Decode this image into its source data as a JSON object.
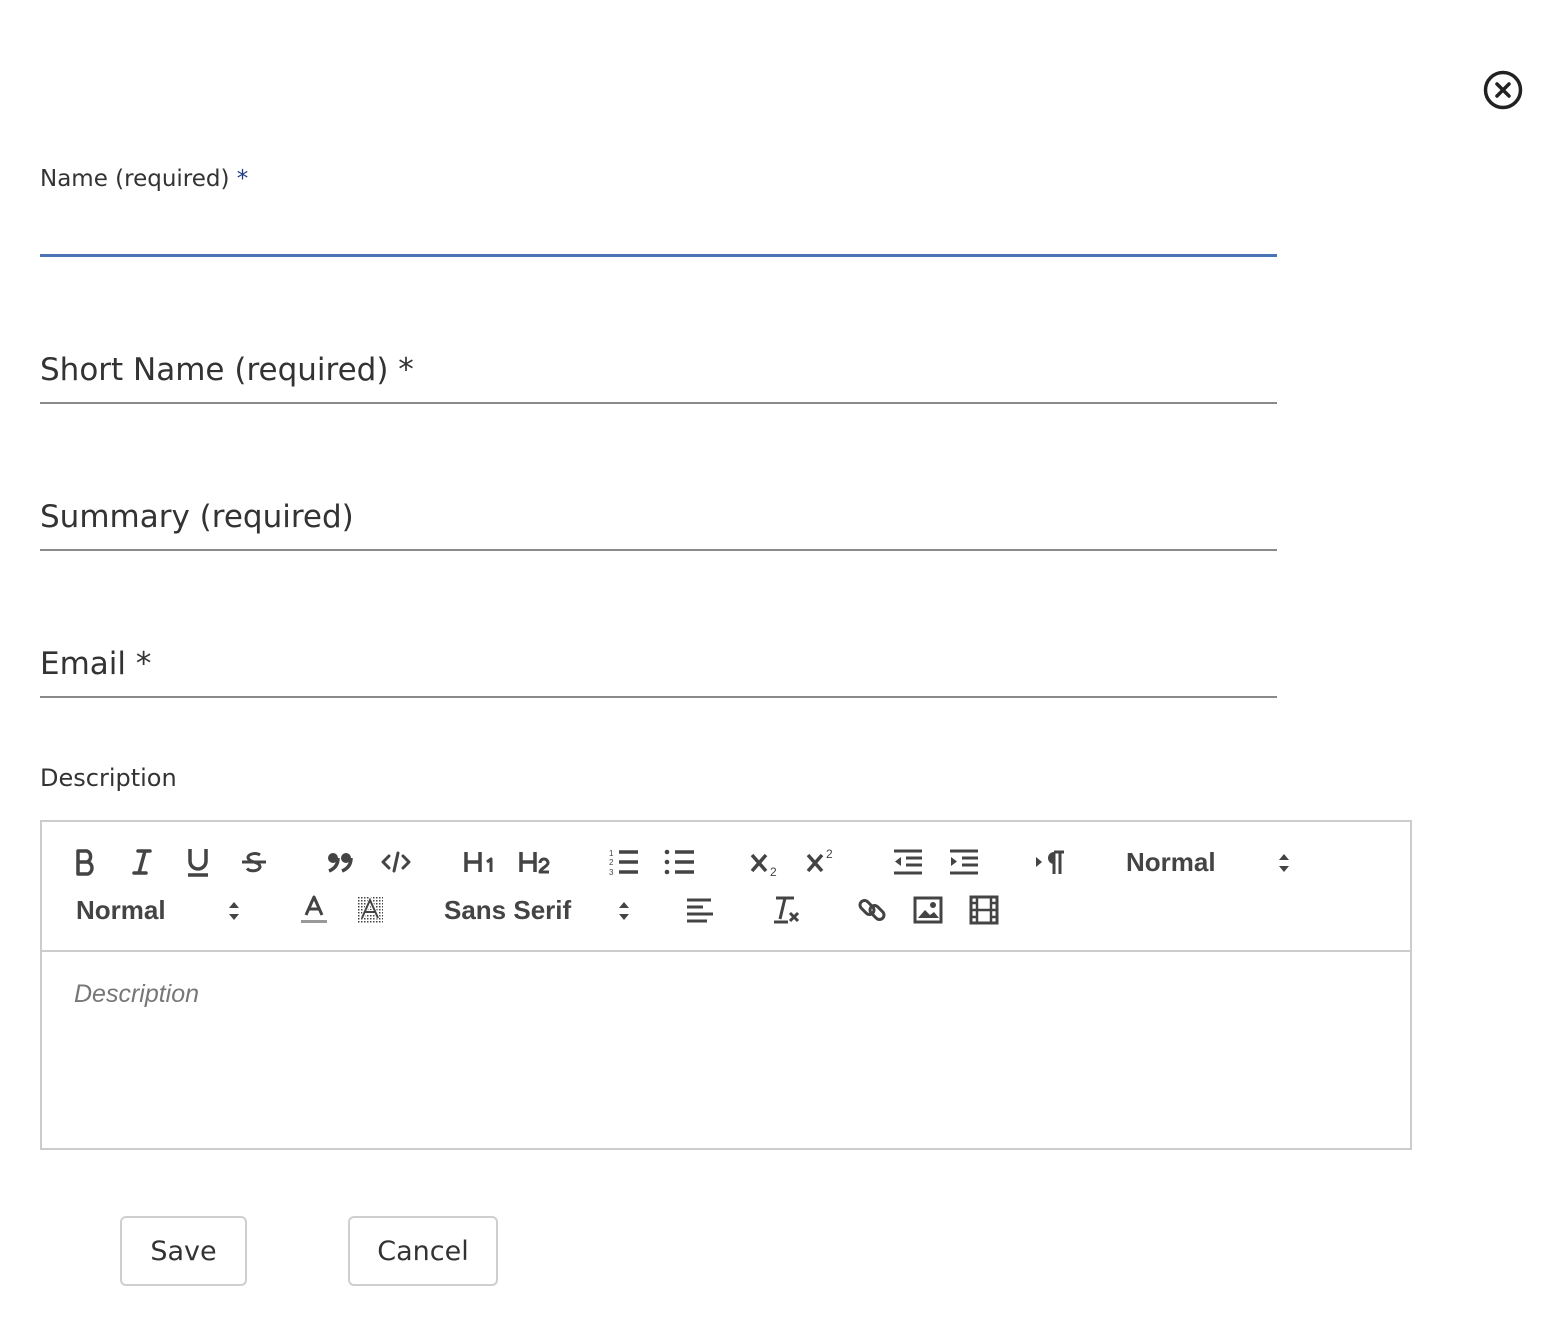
{
  "dialog": {
    "close_icon": "close-circle-icon"
  },
  "fields": {
    "name": {
      "label": "Name (required)",
      "required_mark": "*",
      "value": ""
    },
    "short_name": {
      "label": "Short Name (required) *",
      "value": ""
    },
    "summary": {
      "label": "Summary (required)",
      "value": ""
    },
    "email": {
      "label": "Email *",
      "value": ""
    }
  },
  "description": {
    "label": "Description",
    "placeholder": "Description",
    "toolbar": {
      "header_picker": "Normal",
      "size_picker": "Normal",
      "font_picker": "Sans Serif",
      "buttons": [
        "bold",
        "italic",
        "underline",
        "strike",
        "blockquote",
        "code-block",
        "header-1",
        "header-2",
        "ordered-list",
        "bullet-list",
        "subscript",
        "superscript",
        "outdent",
        "indent",
        "direction-rtl",
        "color",
        "background",
        "align",
        "clean",
        "link",
        "image",
        "video"
      ]
    }
  },
  "actions": {
    "save_label": "Save",
    "cancel_label": "Cancel"
  },
  "colors": {
    "focus_underline": "#4a74b6",
    "required_star": "#1f3a8a",
    "field_underline": "#8a8a8a",
    "border": "#cccccc"
  }
}
